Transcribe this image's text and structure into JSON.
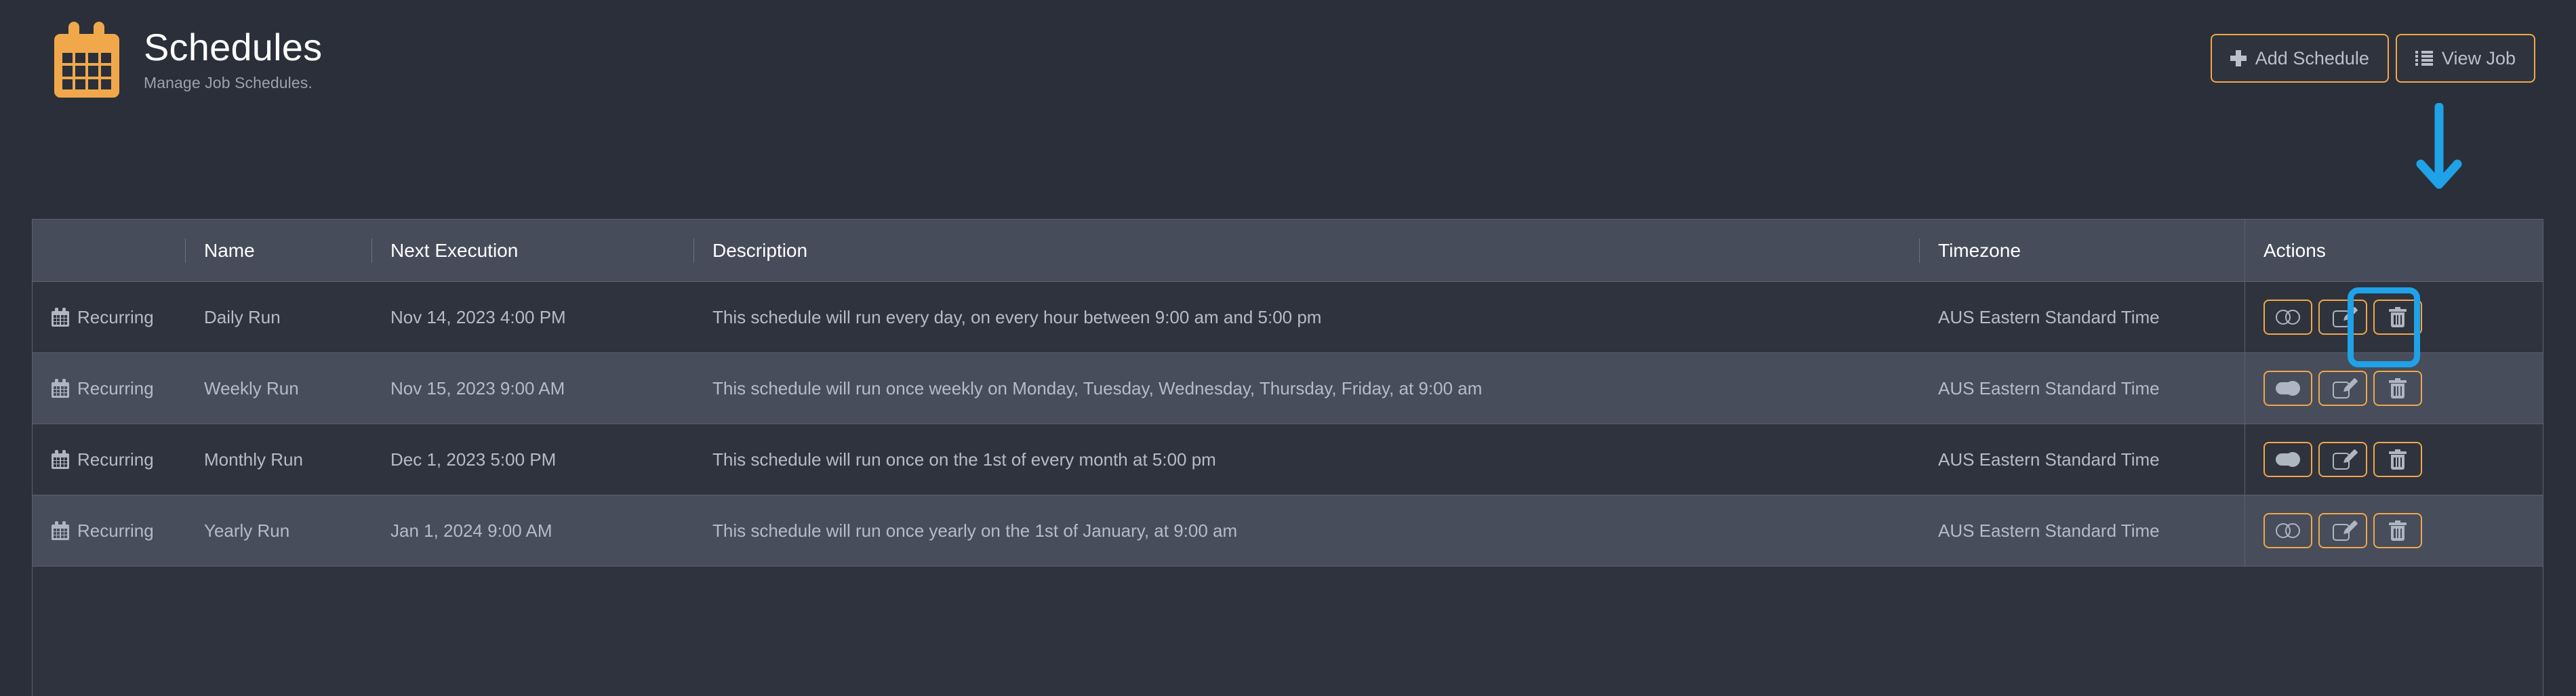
{
  "header": {
    "logo_icon": "calendar-icon",
    "title": "Schedules",
    "subtitle": "Manage Job Schedules.",
    "buttons": [
      {
        "label": "Add Schedule",
        "icon": "plus-icon"
      },
      {
        "label": "View Job",
        "icon": "list-icon"
      }
    ]
  },
  "table": {
    "columns": [
      {
        "key": "type",
        "label": ""
      },
      {
        "key": "name",
        "label": "Name"
      },
      {
        "key": "next",
        "label": "Next Execution"
      },
      {
        "key": "description",
        "label": "Description"
      },
      {
        "key": "timezone",
        "label": "Timezone"
      },
      {
        "key": "actions",
        "label": "Actions"
      }
    ],
    "rows": [
      {
        "type_icon": "calendar-icon",
        "type": "Recurring",
        "name": "Daily Run",
        "next": "Nov 14, 2023 4:00 PM",
        "description": "This schedule will run every day, on every hour between 9:00 am and 5:00 pm",
        "timezone": "AUS Eastern Standard Time",
        "enabled": false
      },
      {
        "type_icon": "calendar-icon",
        "type": "Recurring",
        "name": "Weekly Run",
        "next": "Nov 15, 2023 9:00 AM",
        "description": "This schedule will run once weekly on Monday, Tuesday, Wednesday, Thursday, Friday, at 9:00 am",
        "timezone": "AUS Eastern Standard Time",
        "enabled": true
      },
      {
        "type_icon": "calendar-icon",
        "type": "Recurring",
        "name": "Monthly Run",
        "next": "Dec 1, 2023 5:00 PM",
        "description": "This schedule will run once on the 1st of every month at 5:00 pm",
        "timezone": "AUS Eastern Standard Time",
        "enabled": true
      },
      {
        "type_icon": "calendar-icon",
        "type": "Recurring",
        "name": "Yearly Run",
        "next": "Jan 1, 2024 9:00 AM",
        "description": "This schedule will run once yearly on the 1st of January, at 9:00 am",
        "timezone": "AUS Eastern Standard Time",
        "enabled": false
      }
    ],
    "row_actions": [
      {
        "name": "toggle-button",
        "icon": "toggle-icon"
      },
      {
        "name": "edit-button",
        "icon": "edit-pencil-icon"
      },
      {
        "name": "delete-button",
        "icon": "trash-icon"
      }
    ]
  },
  "annotation": {
    "arrow_icon": "down-arrow-icon",
    "highlight_target": "delete-button-row-1",
    "color": "#1fa2e8"
  },
  "colors": {
    "page_background": "#2b2f39",
    "accent": "#f0a84b",
    "header_row": "#464c59",
    "row_odd": "#2f333d",
    "row_even": "#474d5a",
    "text_primary": "#ffffff",
    "text_secondary": "#b4bcc8",
    "annotation": "#1fa2e8"
  }
}
